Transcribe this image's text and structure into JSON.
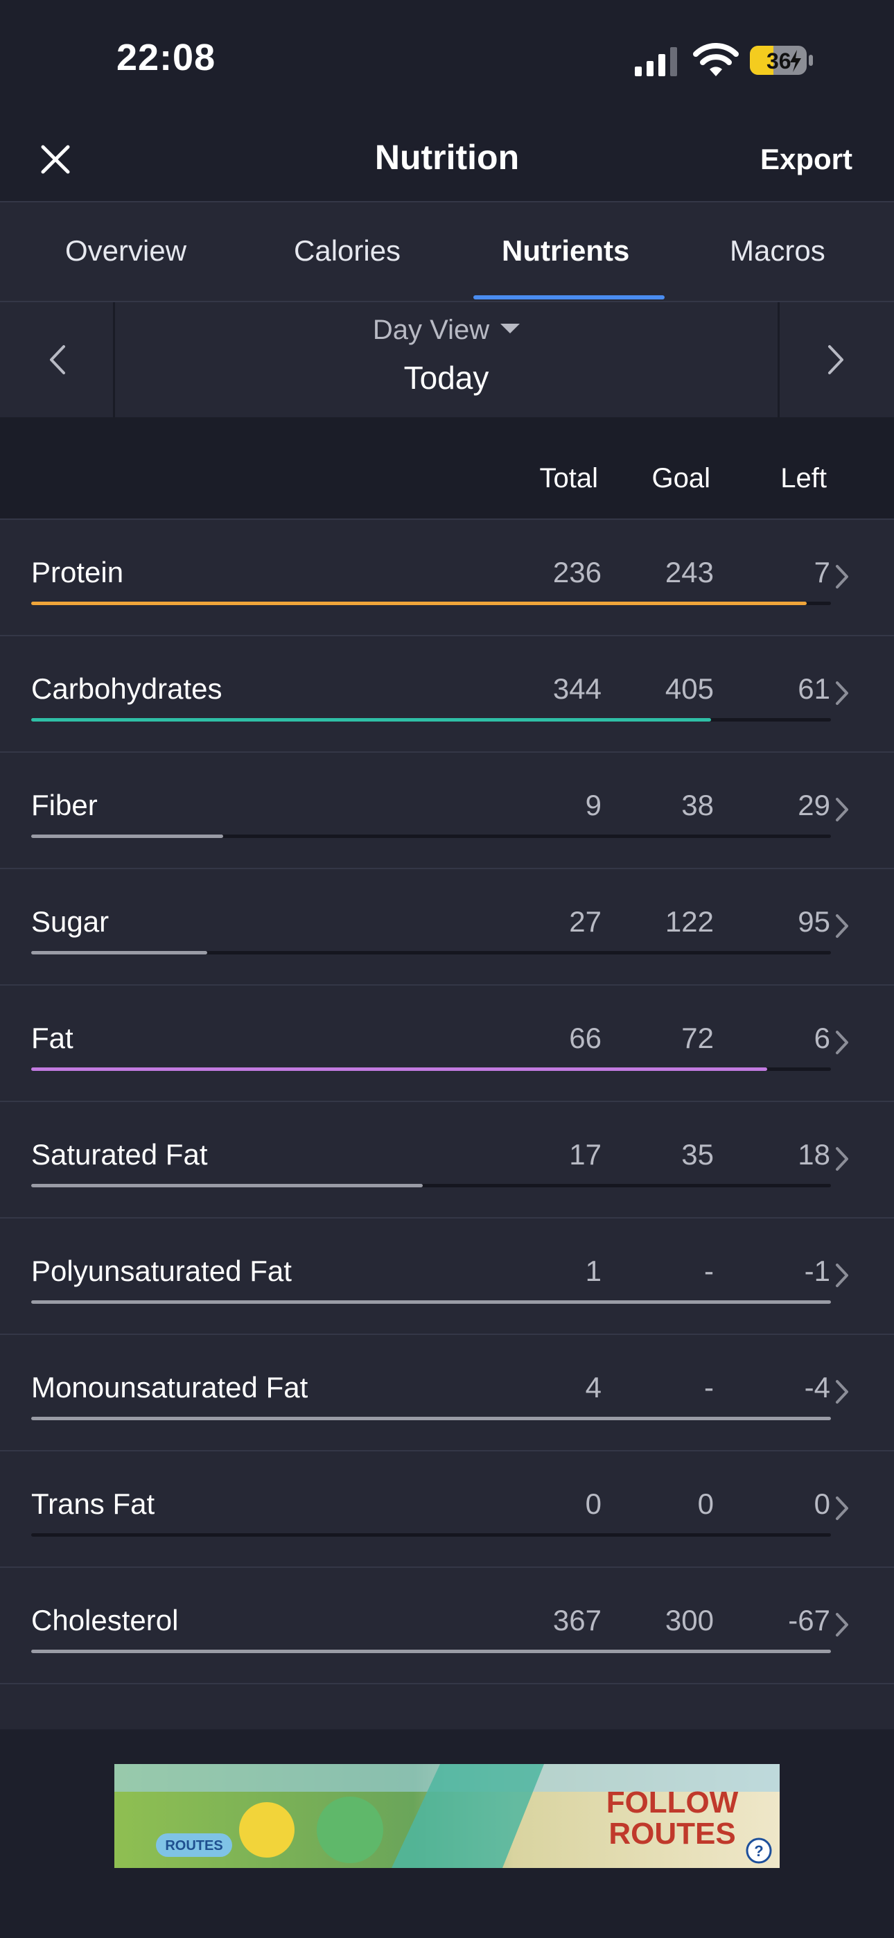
{
  "status": {
    "time": "22:08",
    "battery": "36"
  },
  "header": {
    "title": "Nutrition",
    "export_label": "Export"
  },
  "tabs": [
    {
      "label": "Overview",
      "active": false
    },
    {
      "label": "Calories",
      "active": false
    },
    {
      "label": "Nutrients",
      "active": true
    },
    {
      "label": "Macros",
      "active": false
    }
  ],
  "day_nav": {
    "view_label": "Day View",
    "date_label": "Today"
  },
  "columns": {
    "total": "Total",
    "goal": "Goal",
    "left": "Left"
  },
  "nutrients": [
    {
      "name": "Protein",
      "total": "236",
      "goal": "243",
      "left": "7",
      "progress": 0.97,
      "color": "#f0a53a"
    },
    {
      "name": "Carbohydrates",
      "total": "344",
      "goal": "405",
      "left": "61",
      "progress": 0.85,
      "color": "#2fbfa6"
    },
    {
      "name": "Fiber",
      "total": "9",
      "goal": "38",
      "left": "29",
      "progress": 0.24,
      "color": "#9a9ca6"
    },
    {
      "name": "Sugar",
      "total": "27",
      "goal": "122",
      "left": "95",
      "progress": 0.22,
      "color": "#9a9ca6"
    },
    {
      "name": "Fat",
      "total": "66",
      "goal": "72",
      "left": "6",
      "progress": 0.92,
      "color": "#c27be0"
    },
    {
      "name": "Saturated Fat",
      "total": "17",
      "goal": "35",
      "left": "18",
      "progress": 0.49,
      "color": "#9a9ca6"
    },
    {
      "name": "Polyunsaturated Fat",
      "total": "1",
      "goal": "-",
      "left": "-1",
      "progress": 1.0,
      "color": "#9a9ca6"
    },
    {
      "name": "Monounsaturated Fat",
      "total": "4",
      "goal": "-",
      "left": "-4",
      "progress": 1.0,
      "color": "#9a9ca6"
    },
    {
      "name": "Trans Fat",
      "total": "0",
      "goal": "0",
      "left": "0",
      "progress": 0,
      "color": "#9a9ca6"
    },
    {
      "name": "Cholesterol",
      "total": "367",
      "goal": "300",
      "left": "-67",
      "progress": 1.0,
      "color": "#9a9ca6"
    }
  ],
  "ad": {
    "line1": "FOLLOW",
    "line2": "ROUTES",
    "brand": "ROUTES"
  }
}
